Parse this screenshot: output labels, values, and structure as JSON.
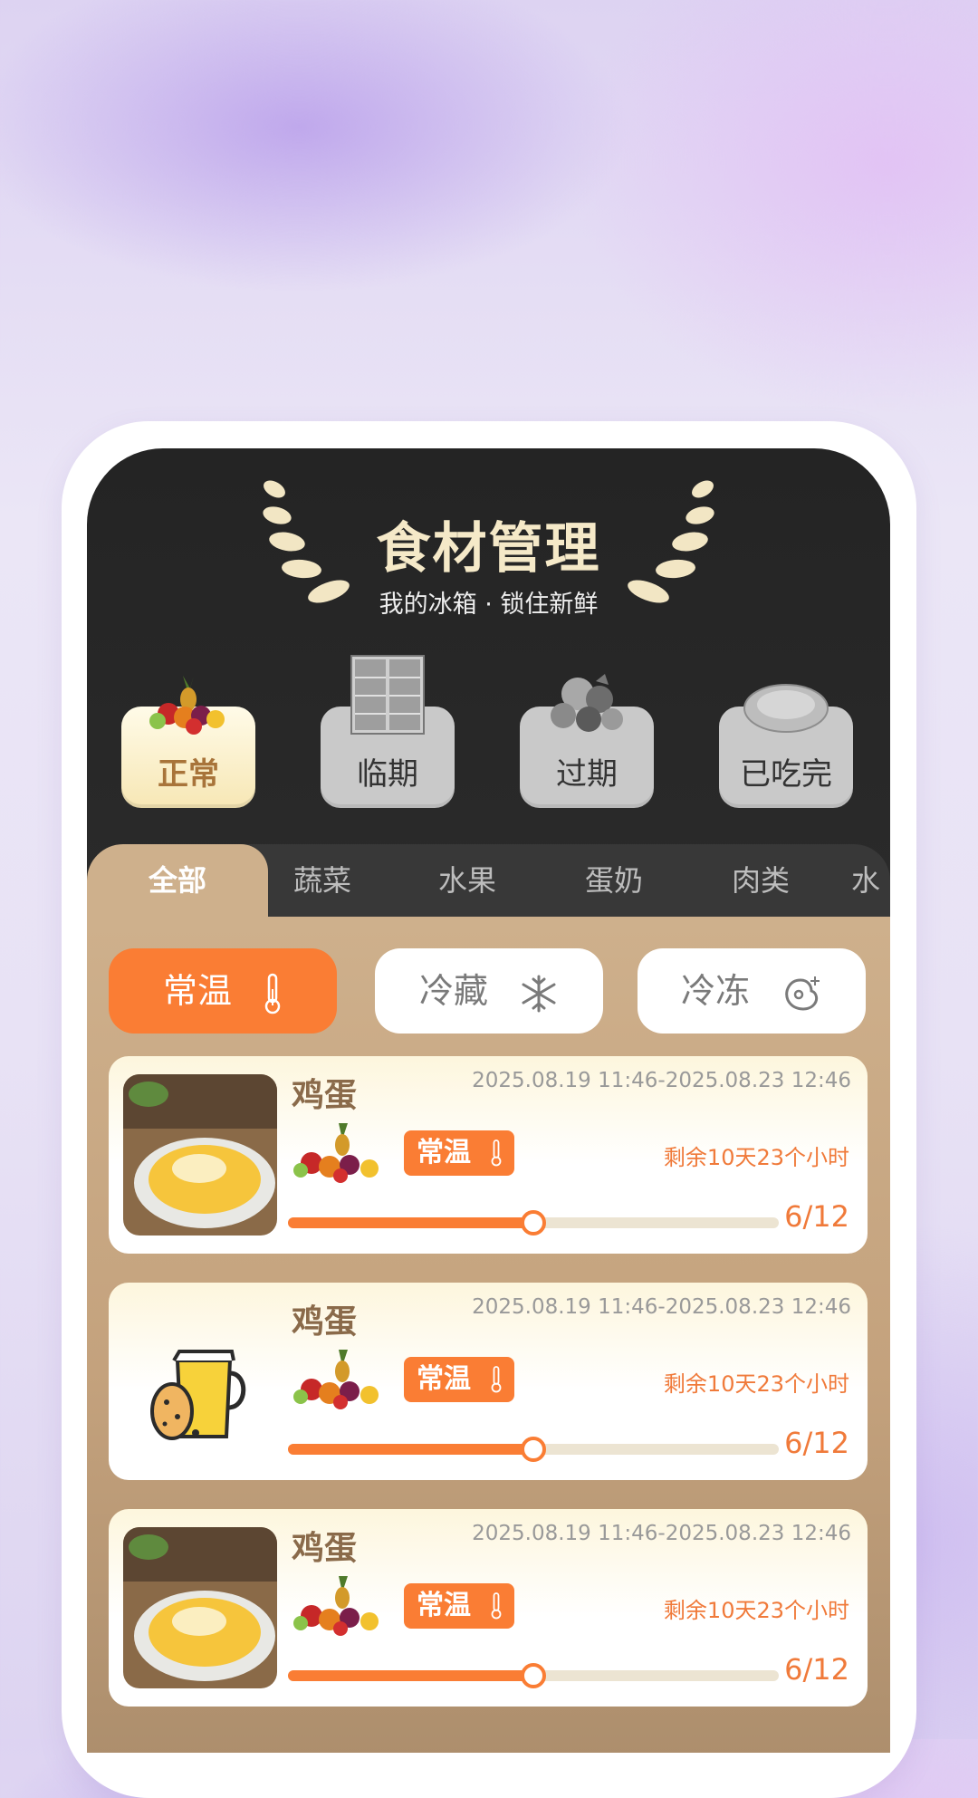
{
  "header": {
    "title": "食材管理",
    "subtitle": "我的冰箱 · 锁住新鲜"
  },
  "status_tabs": [
    {
      "label": "正常",
      "icon": "fruit-basket-icon",
      "active": true
    },
    {
      "label": "临期",
      "icon": "fridge-icon",
      "active": false
    },
    {
      "label": "过期",
      "icon": "vegetables-icon",
      "active": false
    },
    {
      "label": "已吃完",
      "icon": "empty-plate-icon",
      "active": false
    }
  ],
  "category_tabs": [
    "全部",
    "蔬菜",
    "水果",
    "蛋奶",
    "肉类",
    "水"
  ],
  "storage_buttons": [
    {
      "label": "常温",
      "icon": "thermometer-icon",
      "active": true
    },
    {
      "label": "冷藏",
      "icon": "snowflake-icon",
      "active": false
    },
    {
      "label": "冷冻",
      "icon": "frozen-meat-icon",
      "active": false
    }
  ],
  "items": [
    {
      "name": "鸡蛋",
      "date_range": "2025.08.19 11:46-2025.08.23 12:46",
      "tag": "常温",
      "remaining": "剩余10天23个小时",
      "count": "6/12",
      "progress": 0.5,
      "thumb": "egg-photo"
    },
    {
      "name": "鸡蛋",
      "date_range": "2025.08.19 11:46-2025.08.23 12:46",
      "tag": "常温",
      "remaining": "剩余10天23个小时",
      "count": "6/12",
      "progress": 0.5,
      "thumb": "egg-milk-illustration"
    },
    {
      "name": "鸡蛋",
      "date_range": "2025.08.19 11:46-2025.08.23 12:46",
      "tag": "常温",
      "remaining": "剩余10天23个小时",
      "count": "6/12",
      "progress": 0.5,
      "thumb": "egg-photo"
    }
  ],
  "colors": {
    "accent": "#fa7d34",
    "header_bg": "#262626",
    "panel": "#ceb08c",
    "title": "#f5e9c8"
  }
}
